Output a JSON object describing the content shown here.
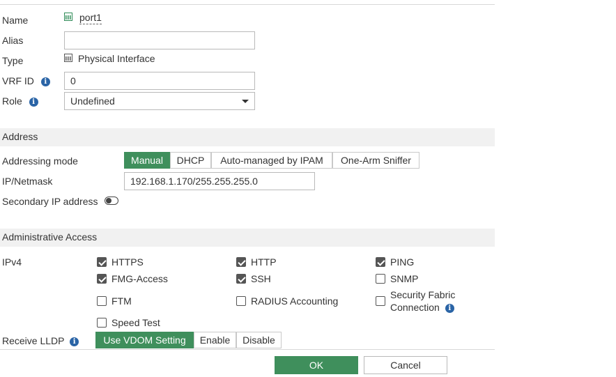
{
  "general": {
    "name_label": "Name",
    "name_value": "port1",
    "alias_label": "Alias",
    "alias_value": "",
    "type_label": "Type",
    "type_value": "Physical Interface",
    "vrf_label": "VRF ID",
    "vrf_value": "0",
    "role_label": "Role",
    "role_value": "Undefined"
  },
  "address": {
    "section_title": "Address",
    "mode_label": "Addressing mode",
    "modes": [
      "Manual",
      "DHCP",
      "Auto-managed by IPAM",
      "One-Arm Sniffer"
    ],
    "selected_mode": "Manual",
    "ip_label": "IP/Netmask",
    "ip_value": "192.168.1.170/255.255.255.0",
    "secondary_label": "Secondary IP address",
    "secondary_enabled": false
  },
  "admin_access": {
    "section_title": "Administrative Access",
    "ipv4_label": "IPv4",
    "options": [
      {
        "label": "HTTPS",
        "checked": true
      },
      {
        "label": "HTTP",
        "checked": true
      },
      {
        "label": "PING",
        "checked": true
      },
      {
        "label": "FMG-Access",
        "checked": true
      },
      {
        "label": "SSH",
        "checked": true
      },
      {
        "label": "SNMP",
        "checked": false
      },
      {
        "label": "FTM",
        "checked": false
      },
      {
        "label": "RADIUS Accounting",
        "checked": false
      },
      {
        "label": "Security Fabric",
        "label_line2": "Connection",
        "checked": false
      },
      {
        "label": "Speed Test",
        "checked": false
      }
    ],
    "lldp_label": "Receive LLDP",
    "lldp_options": [
      "Use VDOM Setting",
      "Enable",
      "Disable"
    ],
    "lldp_selected": "Use VDOM Setting"
  },
  "footer": {
    "ok_label": "OK",
    "cancel_label": "Cancel"
  },
  "colors": {
    "accent_green": "#3f8f5c",
    "info_blue": "#2a64a6",
    "section_bg": "#f1f1f1"
  },
  "icons": {
    "info": "info-circle-icon",
    "interface": "network-port-icon"
  }
}
